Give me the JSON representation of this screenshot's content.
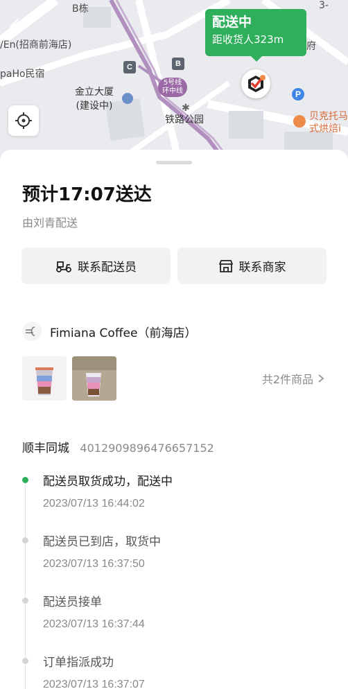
{
  "map": {
    "labels": {
      "building_b": "B栋",
      "store_left": "/En(招商前海店)",
      "hostel": "paHo民宿",
      "jinli": "金立大厦",
      "jinli_sub": "(建设中)",
      "station": "铁路公园",
      "metro_line_1": "5号线",
      "metro_line_2": "环中线",
      "right_edge_1": "府",
      "right_edge_2": "贝克托马",
      "right_edge_3": "式烘焙i",
      "corner_num": "3-",
      "marker_c": "C",
      "marker_b": "B",
      "parking": "P"
    },
    "status_title": "配送中",
    "status_distance": "距收货人323m"
  },
  "order": {
    "eta": "预计17:07送达",
    "rider": "由刘青配送",
    "contact_rider": "联系配送员",
    "contact_shop": "联系商家",
    "shop_name": "Fimiana Coffee（前海店）",
    "goods_count": "共2件商品",
    "carrier": "顺丰同城",
    "tracking_no": "4012909896476657152"
  },
  "timeline": [
    {
      "text": "配送员取货成功，配送中",
      "time": "2023/07/13 16:44:02",
      "active": true
    },
    {
      "text": "配送员已到店，取货中",
      "time": "2023/07/13 16:37:50",
      "active": false
    },
    {
      "text": "配送员接单",
      "time": "2023/07/13 16:37:44",
      "active": false
    },
    {
      "text": "订单指派成功",
      "time": "2023/07/13 16:37:07",
      "active": false
    }
  ],
  "colors": {
    "accent_green": "#2fae5c",
    "metro_purple": "#9b6aa6"
  }
}
